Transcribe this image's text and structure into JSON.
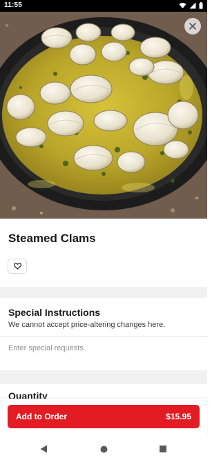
{
  "status_bar": {
    "time": "11:55"
  },
  "item": {
    "title": "Steamed Clams",
    "image_alt": "steamed-clams-photo"
  },
  "special_instructions": {
    "title": "Special Instructions",
    "subtitle": "We cannot accept price-altering changes here.",
    "placeholder": "Enter special requests",
    "value": ""
  },
  "quantity": {
    "title": "Quantity"
  },
  "order_button": {
    "label": "Add to Order",
    "price": "$15.95"
  },
  "icons": {
    "close": "close-icon",
    "favorite": "heart-icon",
    "back": "back-icon",
    "home": "home-icon",
    "recents": "recents-icon",
    "wifi": "wifi-icon",
    "signal": "signal-icon",
    "battery": "battery-icon"
  },
  "colors": {
    "accent": "#e31b23",
    "status_bar": "#000000",
    "divider": "#f1f1f1"
  }
}
